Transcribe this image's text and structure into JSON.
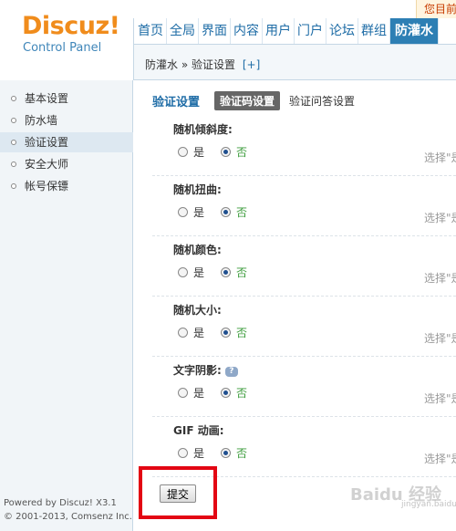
{
  "logo": {
    "title": "Discuz!",
    "subtitle": "Control Panel"
  },
  "top_note": "您目前",
  "nav": [
    "首页",
    "全局",
    "界面",
    "内容",
    "用户",
    "门户",
    "论坛",
    "群组",
    "防灌水"
  ],
  "breadcrumb": {
    "parent": "防灌水",
    "sep": "»",
    "current": "验证设置",
    "add": "[+]"
  },
  "sidebar": {
    "items": [
      {
        "label": "基本设置"
      },
      {
        "label": "防水墙"
      },
      {
        "label": "验证设置"
      },
      {
        "label": "安全大师"
      },
      {
        "label": "帐号保镖"
      }
    ],
    "footer_line1": "Powered by Discuz! X3.1",
    "footer_line2": "© 2001-2013, Comsenz Inc."
  },
  "tabs": {
    "title": "验证设置",
    "items": [
      "验证码设置",
      "验证问答设置"
    ]
  },
  "settings": [
    {
      "label": "随机倾斜度:",
      "yes": "是",
      "no": "否",
      "hint": "选择\"是"
    },
    {
      "label": "随机扭曲:",
      "yes": "是",
      "no": "否",
      "hint": "选择\"是"
    },
    {
      "label": "随机颜色:",
      "yes": "是",
      "no": "否",
      "hint": "选择\"是"
    },
    {
      "label": "随机大小:",
      "yes": "是",
      "no": "否",
      "hint": "选择\"是"
    },
    {
      "label": "文字阴影:",
      "yes": "是",
      "no": "否",
      "hint": "选择\"是"
    },
    {
      "label": "GIF 动画:",
      "yes": "是",
      "no": "否",
      "hint": "选择\"是"
    }
  ],
  "submit_label": "提交",
  "watermark": {
    "main": "Baidu 经验",
    "sub": "jingyan.baidu.com"
  },
  "colors": {
    "accent": "#1e6ca6",
    "logo": "#f08c1c",
    "highlight": "#e30613",
    "nav_active": "#2d7fb4"
  }
}
